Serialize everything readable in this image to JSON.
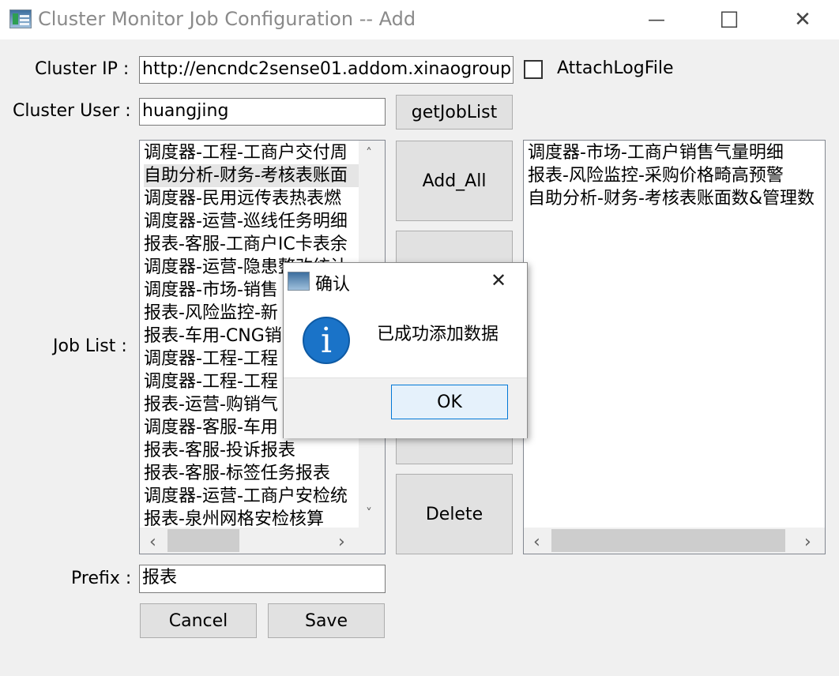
{
  "window": {
    "title": "Cluster Monitor Job Configuration -- Add",
    "minimize_glyph": "—",
    "maximize_glyph": "☐",
    "close_glyph": "✕"
  },
  "form": {
    "cluster_ip_label": "Cluster IP :",
    "cluster_ip_value": "http://encndc2sense01.addom.xinaogroup.c",
    "attach_log_label": "AttachLogFile",
    "attach_log_checked": false,
    "cluster_user_label": "Cluster User :",
    "cluster_user_value": "huangjing",
    "get_job_list_label": "getJobList",
    "job_list_label": "Job List :",
    "prefix_label": "Prefix :",
    "prefix_value": "报表",
    "cancel_label": "Cancel",
    "save_label": "Save",
    "add_all_label": "Add_All",
    "delete_label": "Delete"
  },
  "job_list": [
    "调度器-工程-工商户交付周",
    "自助分析-财务-考核表账面",
    "调度器-民用远传表热表燃",
    "调度器-运营-巡线任务明细",
    "报表-客服-工商户IC卡表余",
    "调度器-运营-隐患整改统计",
    "调度器-市场-销售",
    "报表-风险监控-新",
    "报表-车用-CNG销",
    "调度器-工程-工程",
    "调度器-工程-工程",
    "报表-运营-购销气",
    "调度器-客服-车用",
    "报表-客服-投诉报表",
    "报表-客服-标签任务报表",
    "调度器-运营-工商户安检统",
    "报表-泉州网格安检核算"
  ],
  "job_list_selected_index": 1,
  "selected_jobs": [
    "调度器-市场-工商户销售气量明细",
    "报表-风险监控-采购价格畸高预警",
    "自助分析-财务-考核表账面数&管理数"
  ],
  "dialog": {
    "title": "确认",
    "message": "已成功添加数据",
    "ok_label": "OK",
    "close_glyph": "✕",
    "info_glyph": "i"
  },
  "scroll": {
    "up": "˄",
    "down": "˅",
    "left": "‹",
    "right": "›"
  }
}
